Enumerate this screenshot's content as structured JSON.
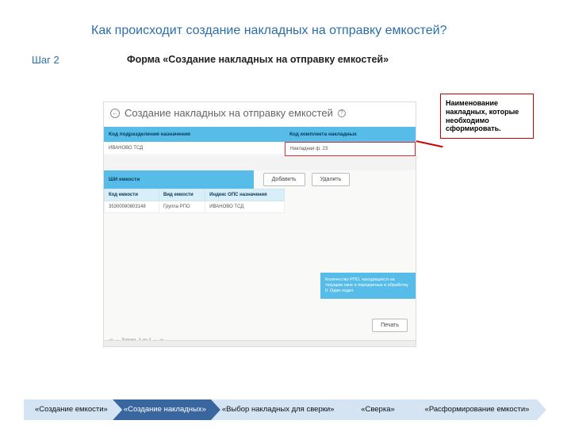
{
  "slide": {
    "title": "Как происходит создание накладных на отправку емкостей?",
    "step": "Шаг 2",
    "form_label": "Форма «Создание накладных на отправку емкостей»"
  },
  "callout": "Наименование накладных, которые необходимо сформировать.",
  "app": {
    "title": "Создание накладных на отправку емкостей",
    "dest_label": "Код подразделения назначения",
    "dest_value": "ИВАНОВО ТСД",
    "set_label": "Код комплекта накладных",
    "set_value": "Накладная ф. 23",
    "shi_label": "ШИ емкости",
    "btn_add": "Добавить",
    "btn_del": "Удалить",
    "col_code": "Код емкости",
    "col_type": "Вид емкости",
    "col_index": "Индекс ОПС назначения",
    "row_code": "35300080803148",
    "row_type": "Группа РПО",
    "row_index": "ИВАНОВО ТСД",
    "right_panel": "Количество РПО, находящихся на текущем окне и переданные в обработку 0. Один ходит.",
    "btn_print": "Печать",
    "pager": "Запись 1 из 1"
  },
  "chevrons": {
    "c1": "«Создание емкости»",
    "c2": "«Создание накладных»",
    "c3": "«Выбор накладных для сверки»",
    "c4": "«Сверка»",
    "c5": "«Расформирование емкости»"
  }
}
